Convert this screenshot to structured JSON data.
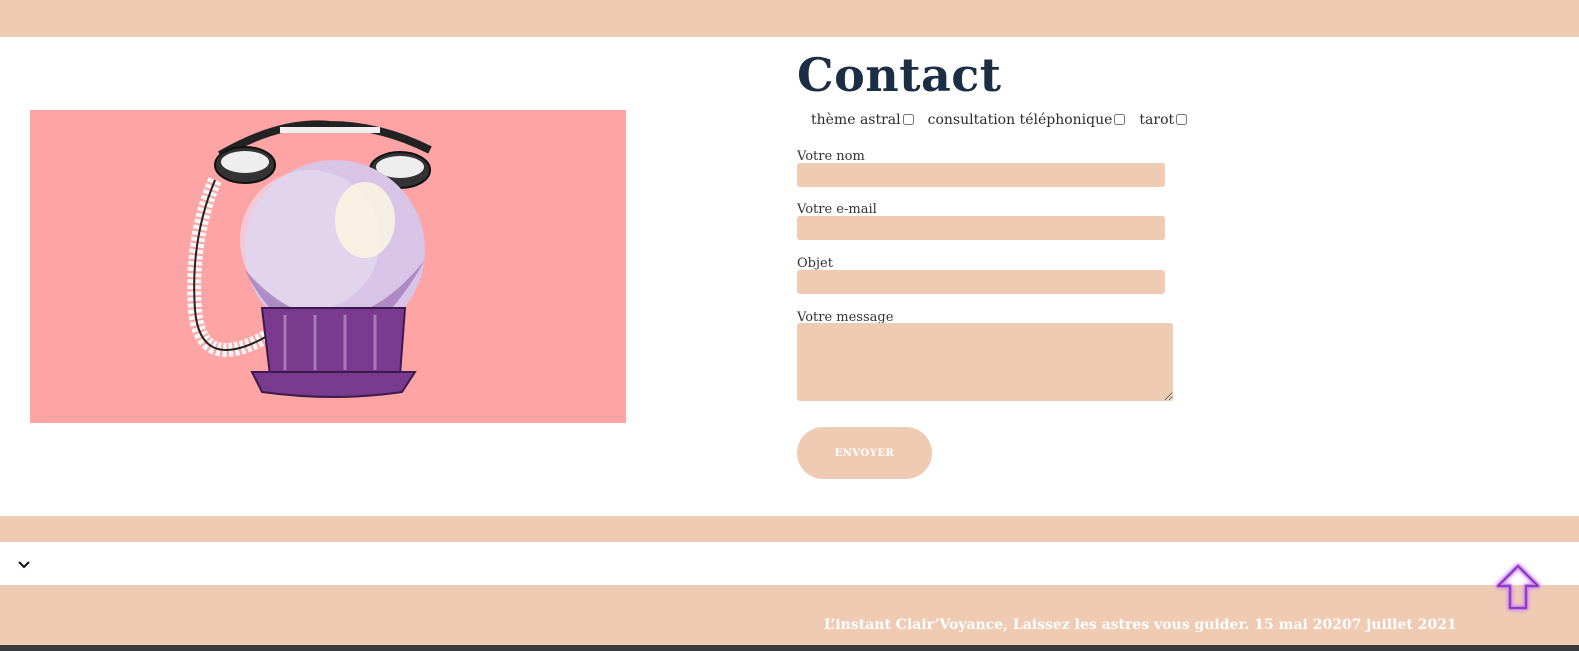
{
  "page": {
    "title": "Contact"
  },
  "form": {
    "options": [
      {
        "label": "thème astral",
        "checked": false
      },
      {
        "label": "consultation téléphonique",
        "checked": false
      },
      {
        "label": "tarot",
        "checked": false
      }
    ],
    "name_label": "Votre nom",
    "email_label": "Votre e-mail",
    "subject_label": "Objet",
    "message_label": "Votre message",
    "submit_label": "ENVOYER"
  },
  "footer": {
    "text": "L’instant Clair’Voyance, Laissez les astres vous guider. 15 mai 20207 juillet 2021"
  },
  "colors": {
    "band": "#efcbb4",
    "image_bg": "#fea4a4",
    "title": "#1b2e44",
    "crystal_ball_base": "#7a3b8f",
    "scroll_top_glow": "#c67cf0"
  },
  "icons": {
    "hero": "crystal-ball-telephone-illustration",
    "expand": "chevron-down-icon",
    "scroll_top": "arrow-up-icon"
  }
}
